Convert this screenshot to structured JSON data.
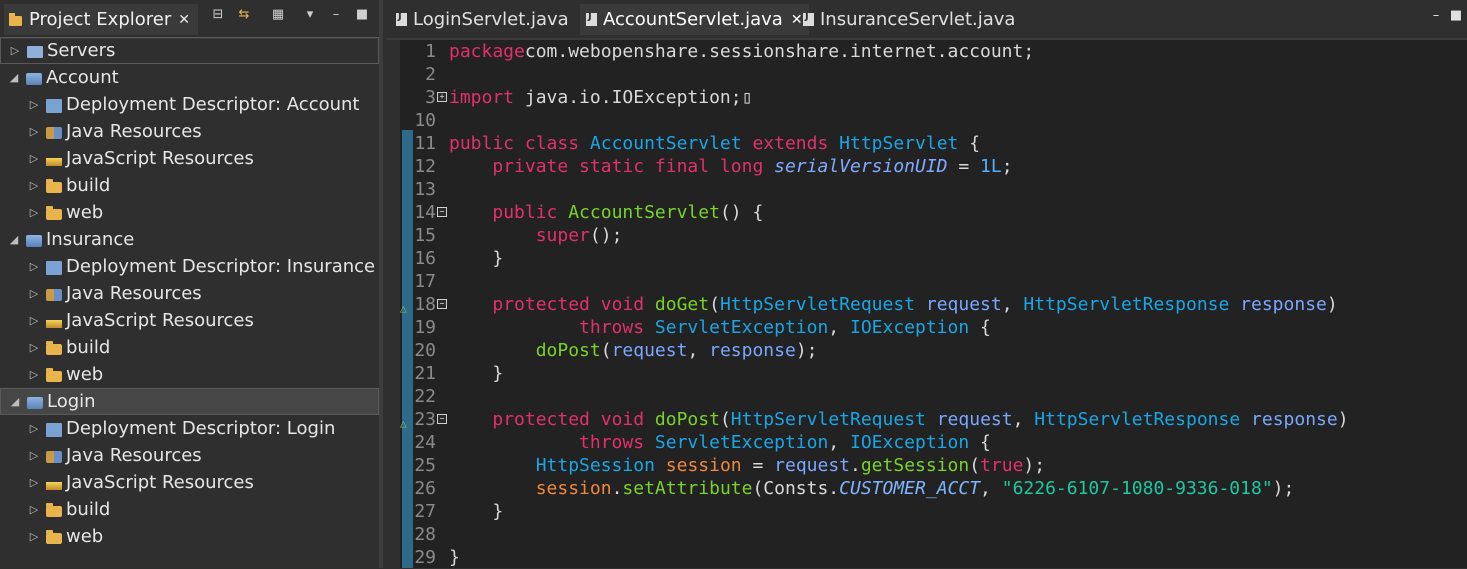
{
  "explorer": {
    "title": "Project Explorer",
    "close_glyph": "✕",
    "toolbar": [
      "collapse-all-icon",
      "link-with-editor-icon",
      "filter-icon",
      "view-menu-icon",
      "minimize-icon",
      "maximize-icon"
    ],
    "tree": [
      {
        "label": "Servers",
        "depth": 0,
        "icon": "servers-folder-icon",
        "expanded": false
      },
      {
        "label": "Account",
        "depth": 0,
        "icon": "web-project-icon",
        "expanded": true
      },
      {
        "label": "Deployment Descriptor: Account",
        "depth": 1,
        "icon": "deployment-descriptor-icon",
        "expanded": false
      },
      {
        "label": "Java Resources",
        "depth": 1,
        "icon": "java-resources-icon",
        "expanded": false
      },
      {
        "label": "JavaScript Resources",
        "depth": 1,
        "icon": "javascript-resources-icon",
        "expanded": false
      },
      {
        "label": "build",
        "depth": 1,
        "icon": "folder-icon",
        "expanded": false
      },
      {
        "label": "web",
        "depth": 1,
        "icon": "folder-icon",
        "expanded": false
      },
      {
        "label": "Insurance",
        "depth": 0,
        "icon": "web-project-icon",
        "expanded": true
      },
      {
        "label": "Deployment Descriptor: Insurance",
        "depth": 1,
        "icon": "deployment-descriptor-icon",
        "expanded": false
      },
      {
        "label": "Java Resources",
        "depth": 1,
        "icon": "java-resources-icon",
        "expanded": false
      },
      {
        "label": "JavaScript Resources",
        "depth": 1,
        "icon": "javascript-resources-icon",
        "expanded": false
      },
      {
        "label": "build",
        "depth": 1,
        "icon": "folder-icon",
        "expanded": false
      },
      {
        "label": "web",
        "depth": 1,
        "icon": "folder-icon",
        "expanded": false
      },
      {
        "label": "Login",
        "depth": 0,
        "icon": "web-project-icon",
        "expanded": true,
        "selected": true
      },
      {
        "label": "Deployment Descriptor: Login",
        "depth": 1,
        "icon": "deployment-descriptor-icon",
        "expanded": false
      },
      {
        "label": "Java Resources",
        "depth": 1,
        "icon": "java-resources-icon",
        "expanded": false
      },
      {
        "label": "JavaScript Resources",
        "depth": 1,
        "icon": "javascript-resources-icon",
        "expanded": false
      },
      {
        "label": "build",
        "depth": 1,
        "icon": "folder-icon",
        "expanded": false
      },
      {
        "label": "web",
        "depth": 1,
        "icon": "folder-icon",
        "expanded": false
      }
    ]
  },
  "editor": {
    "tabs": [
      {
        "label": "LoginServlet.java",
        "active": false
      },
      {
        "label": "AccountServlet.java",
        "active": true,
        "close": "✕"
      },
      {
        "label": "InsuranceServlet.java",
        "active": false
      }
    ],
    "window_buttons": {
      "minimize": "–",
      "maximize": "■"
    },
    "lines": [
      {
        "num": "1",
        "tokens": [
          [
            "kw",
            "package"
          ],
          [
            "",
            "com.webopenshare.sessionshare.internet.account;"
          ]
        ]
      },
      {
        "num": "2",
        "tokens": []
      },
      {
        "num": "3",
        "fold": "+",
        "tokens": [
          [
            "kw",
            "import"
          ],
          [
            "",
            " java.io.IOException;"
          ],
          [
            "",
            "▯"
          ]
        ]
      },
      {
        "num": "10",
        "tokens": []
      },
      {
        "num": "11",
        "tokens": [
          [
            "kw",
            "public class "
          ],
          [
            "ty",
            "AccountServlet"
          ],
          [
            "kw",
            " extends "
          ],
          [
            "ty",
            "HttpServlet"
          ],
          [
            "",
            " {"
          ]
        ]
      },
      {
        "num": "12",
        "tokens": [
          [
            "",
            "    "
          ],
          [
            "kw",
            "private static final long "
          ],
          [
            "fld",
            "serialVersionUID"
          ],
          [
            "",
            " = "
          ],
          [
            "num",
            "1L"
          ],
          [
            "",
            ";"
          ]
        ]
      },
      {
        "num": "13",
        "tokens": []
      },
      {
        "num": "14",
        "fold": "−",
        "tokens": [
          [
            "",
            "    "
          ],
          [
            "kw",
            "public "
          ],
          [
            "fn",
            "AccountServlet"
          ],
          [
            "",
            "() {"
          ]
        ]
      },
      {
        "num": "15",
        "tokens": [
          [
            "",
            "        "
          ],
          [
            "kw",
            "super"
          ],
          [
            "",
            "();"
          ]
        ]
      },
      {
        "num": "16",
        "tokens": [
          [
            "",
            "    }"
          ]
        ]
      },
      {
        "num": "17",
        "tokens": []
      },
      {
        "num": "18",
        "fold": "−",
        "override": "△",
        "tokens": [
          [
            "",
            "    "
          ],
          [
            "kw",
            "protected void "
          ],
          [
            "fn",
            "doGet"
          ],
          [
            "",
            "("
          ],
          [
            "ty",
            "HttpServletRequest"
          ],
          [
            "",
            " "
          ],
          [
            "var",
            "request"
          ],
          [
            "",
            ", "
          ],
          [
            "ty",
            "HttpServletResponse"
          ],
          [
            "",
            " "
          ],
          [
            "var",
            "response"
          ],
          [
            "",
            ")"
          ]
        ]
      },
      {
        "num": "19",
        "tokens": [
          [
            "",
            "            "
          ],
          [
            "kw",
            "throws "
          ],
          [
            "ty",
            "ServletException"
          ],
          [
            "",
            ", "
          ],
          [
            "ty",
            "IOException"
          ],
          [
            "",
            " {"
          ]
        ]
      },
      {
        "num": "20",
        "tokens": [
          [
            "",
            "        "
          ],
          [
            "fn",
            "doPost"
          ],
          [
            "",
            "("
          ],
          [
            "var",
            "request"
          ],
          [
            "",
            ", "
          ],
          [
            "var",
            "response"
          ],
          [
            "",
            ");"
          ]
        ]
      },
      {
        "num": "21",
        "tokens": [
          [
            "",
            "    }"
          ]
        ]
      },
      {
        "num": "22",
        "tokens": []
      },
      {
        "num": "23",
        "fold": "−",
        "override": "△",
        "tokens": [
          [
            "",
            "    "
          ],
          [
            "kw",
            "protected void "
          ],
          [
            "fn",
            "doPost"
          ],
          [
            "",
            "("
          ],
          [
            "ty",
            "HttpServletRequest"
          ],
          [
            "",
            " "
          ],
          [
            "var",
            "request"
          ],
          [
            "",
            ", "
          ],
          [
            "ty",
            "HttpServletResponse"
          ],
          [
            "",
            " "
          ],
          [
            "var",
            "response"
          ],
          [
            "",
            ")"
          ]
        ]
      },
      {
        "num": "24",
        "tokens": [
          [
            "",
            "            "
          ],
          [
            "kw",
            "throws "
          ],
          [
            "ty",
            "ServletException"
          ],
          [
            "",
            ", "
          ],
          [
            "ty",
            "IOException"
          ],
          [
            "",
            " {"
          ]
        ]
      },
      {
        "num": "25",
        "tokens": [
          [
            "",
            "        "
          ],
          [
            "ty",
            "HttpSession"
          ],
          [
            "",
            " "
          ],
          [
            "loc",
            "session"
          ],
          [
            "",
            " = "
          ],
          [
            "var",
            "request"
          ],
          [
            "",
            "."
          ],
          [
            "fn",
            "getSession"
          ],
          [
            "",
            "("
          ],
          [
            "kw",
            "true"
          ],
          [
            "",
            ");"
          ]
        ]
      },
      {
        "num": "26",
        "tokens": [
          [
            "",
            "        "
          ],
          [
            "loc",
            "session"
          ],
          [
            "",
            "."
          ],
          [
            "fn",
            "setAttribute"
          ],
          [
            "",
            "(Consts."
          ],
          [
            "cst",
            "CUSTOMER_ACCT"
          ],
          [
            "",
            ", "
          ],
          [
            "str",
            "\"6226-6107-1080-9336-018\""
          ],
          [
            "",
            ");"
          ]
        ]
      },
      {
        "num": "27",
        "tokens": [
          [
            "",
            "    }"
          ]
        ]
      },
      {
        "num": "28",
        "tokens": []
      },
      {
        "num": "29",
        "tokens": [
          [
            "",
            "}"
          ]
        ]
      }
    ]
  }
}
